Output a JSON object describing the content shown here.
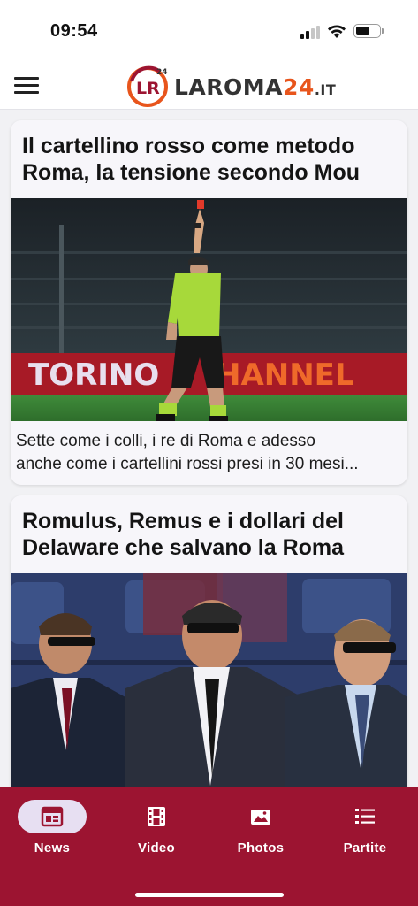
{
  "status_bar": {
    "time": "09:54"
  },
  "header": {
    "logo_text": "LAROMA",
    "logo_number": "24",
    "logo_tld": ".IT",
    "logo_mark_letters": "LR",
    "logo_mark_superscript": "24"
  },
  "articles": [
    {
      "title": "Il cartellino rosso come metodo Roma, la tensione secondo Mou",
      "image_banner_text_left": "TORINO",
      "image_banner_text_right": "HANNEL",
      "excerpt_line1": "Sette come i colli, i re di  Roma  e adesso",
      "excerpt_line2": "anche come i cartellini rossi presi in 30 mesi..."
    },
    {
      "title": "Romulus, Remus e i dollari del Delaware che salvano la Roma"
    }
  ],
  "bottom_nav": {
    "items": [
      {
        "label": "News",
        "icon": "news-icon",
        "active": true
      },
      {
        "label": "Video",
        "icon": "video-icon",
        "active": false
      },
      {
        "label": "Photos",
        "icon": "photos-icon",
        "active": false
      },
      {
        "label": "Partite",
        "icon": "partite-icon",
        "active": false
      }
    ]
  },
  "colors": {
    "brand": "#9c1431",
    "active_pill": "#e7dff2",
    "logo_accent": "#e8551c"
  }
}
